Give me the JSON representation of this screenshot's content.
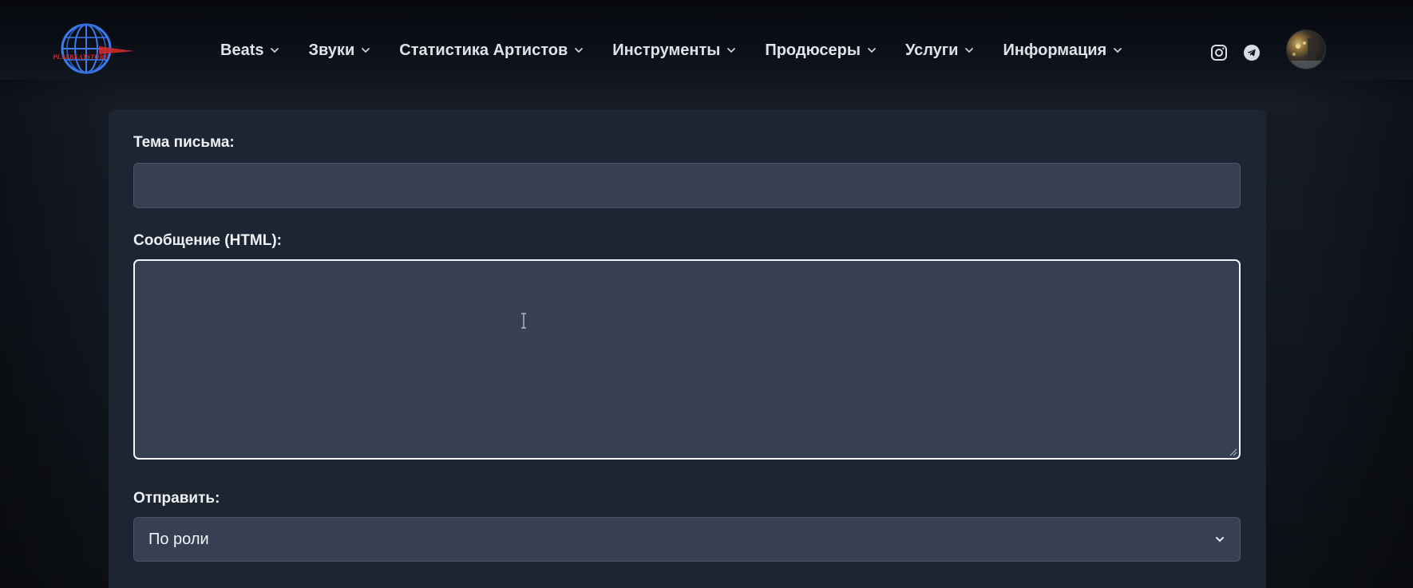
{
  "header": {
    "logo_text": "PLAYBEATSTORE",
    "nav": [
      {
        "label": "Beats"
      },
      {
        "label": "Звуки"
      },
      {
        "label": "Статистика Артистов"
      },
      {
        "label": "Инструменты"
      },
      {
        "label": "Продюсеры"
      },
      {
        "label": "Услуги"
      },
      {
        "label": "Информация"
      }
    ],
    "social_icons": [
      "instagram-icon",
      "telegram-icon"
    ]
  },
  "form": {
    "subject_label": "Тема письма:",
    "subject_value": "",
    "message_label": "Сообщение (HTML):",
    "message_value": "",
    "send_label": "Отправить:",
    "send_selected": "По роли"
  },
  "colors": {
    "page_bg": "#101318",
    "card_bg": "#1e2532",
    "input_bg": "#374052",
    "text": "#eef1f6"
  }
}
